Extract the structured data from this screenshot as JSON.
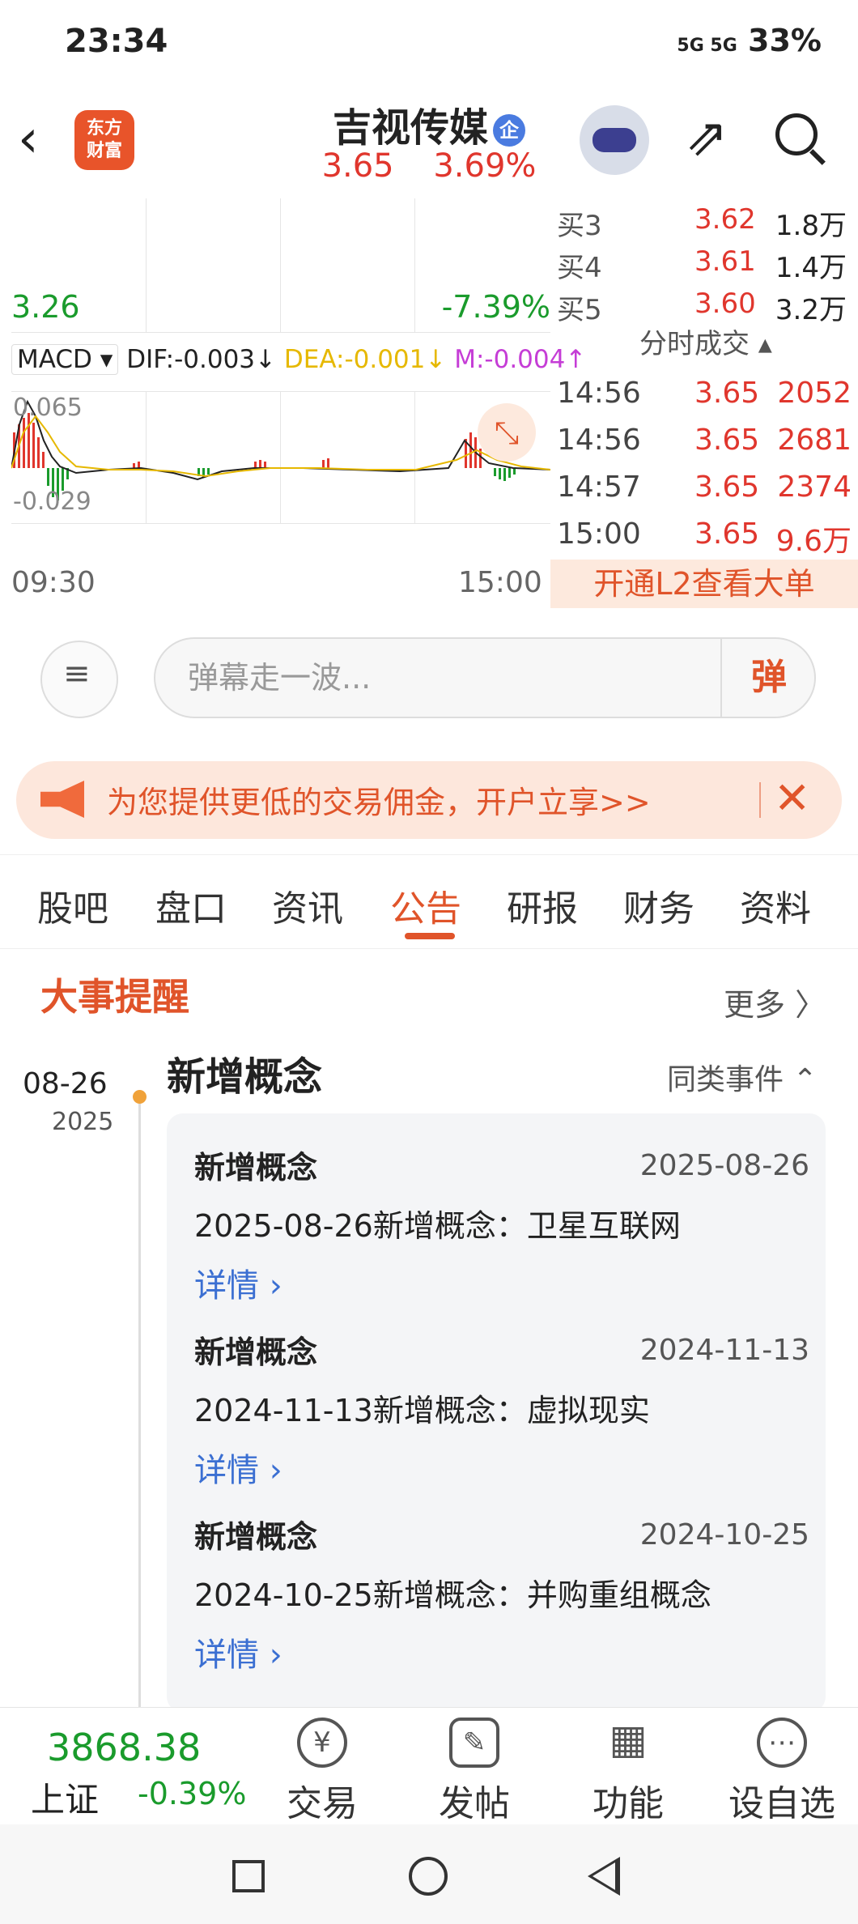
{
  "status": {
    "time": "23:34",
    "signal": "5G 5G",
    "battery": "33%"
  },
  "header": {
    "logo_line1": "东方",
    "logo_line2": "财富",
    "stock_name": "吉视传媒",
    "badge": "企",
    "price": "3.65",
    "change_pct": "3.69%"
  },
  "chart": {
    "low_price": "3.26",
    "low_pct": "-7.39%",
    "macd_label": "MACD",
    "dif": "DIF:-0.003↓",
    "dea": "DEA:-0.001↓",
    "m": "M:-0.004↑",
    "macd_top": "0.065",
    "macd_bottom": "-0.029",
    "time_start": "09:30",
    "time_end": "15:00"
  },
  "order_book": [
    {
      "label": "买3",
      "price": "3.62",
      "vol": "1.8万"
    },
    {
      "label": "买4",
      "price": "3.61",
      "vol": "1.4万"
    },
    {
      "label": "买5",
      "price": "3.60",
      "vol": "3.2万"
    }
  ],
  "fenshi_title": "分时成交",
  "trades": [
    {
      "time": "14:56",
      "price": "3.65",
      "vol": "2052"
    },
    {
      "time": "14:56",
      "price": "3.65",
      "vol": "2681"
    },
    {
      "time": "14:57",
      "price": "3.65",
      "vol": "2374"
    },
    {
      "time": "15:00",
      "price": "3.65",
      "vol": "9.6万"
    }
  ],
  "l2_banner": "开通L2查看大单",
  "danmu": {
    "placeholder": "弹幕走一波...",
    "button": "弹"
  },
  "promo": {
    "text": "为您提供更低的交易佣金，开户立享>>"
  },
  "tabs": [
    "股吧",
    "盘口",
    "资讯",
    "公告",
    "研报",
    "财务",
    "资料"
  ],
  "events": {
    "title": "大事提醒",
    "more": "更多 〉",
    "date_main": "08-26",
    "date_year": "2025",
    "concept_title": "新增概念",
    "same_type": "同类事件 ⌃",
    "items": [
      {
        "title": "新增概念",
        "date": "2025-08-26",
        "desc": "2025-08-26新增概念：卫星互联网",
        "detail": "详情 ›"
      },
      {
        "title": "新增概念",
        "date": "2024-11-13",
        "desc": "2024-11-13新增概念：虚拟现实",
        "detail": "详情 ›"
      },
      {
        "title": "新增概念",
        "date": "2024-10-25",
        "desc": "2024-10-25新增概念：并购重组概念",
        "detail": "详情 ›"
      }
    ]
  },
  "bottom": {
    "index_value": "3868.38",
    "index_name": "上证",
    "index_change": "-0.39%",
    "buttons": [
      {
        "label": "交易",
        "icon": "¥"
      },
      {
        "label": "发帖",
        "icon": "✎"
      },
      {
        "label": "功能",
        "icon": "▦"
      },
      {
        "label": "设自选",
        "icon": "⋯"
      }
    ]
  }
}
